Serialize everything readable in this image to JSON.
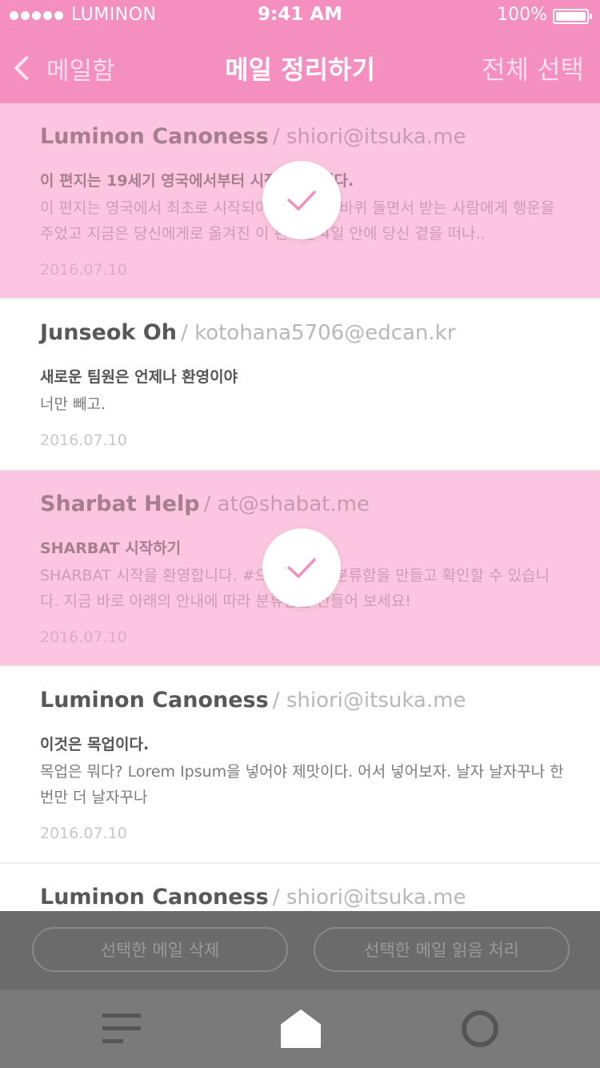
{
  "status_bar": {
    "carrier": "LUMINON",
    "time": "9:41 AM",
    "battery": "100%"
  },
  "nav": {
    "back_label": "메일함",
    "title": "메일 정리하기",
    "action_label": "전체 선택"
  },
  "mails": [
    {
      "sender": "Luminon Canoness",
      "email": "/ shiori@itsuka.me",
      "subject": "이 편지는 19세기 영국에서부터 시작되었습니다.",
      "body": "이 편지는 영국에서 최초로 시작되어 일년에 한 바퀴 돌면서 받는 사람에게 행운을 주었고 지금은 당신에게로 옮겨진 이 편지는 4일 안에 당신 곁을 떠나..",
      "date": "2016.07.10",
      "selected": true
    },
    {
      "sender": "Junseok Oh",
      "email": "/ kotohana5706@edcan.kr",
      "subject": "새로운 팀원은 언제나 환영이야",
      "body": "너만 빼고.",
      "date": "2016.07.10",
      "selected": false
    },
    {
      "sender": "Sharbat Help",
      "email": "/ at@shabat.me",
      "subject": "SHARBAT 시작하기",
      "body": "SHARBAT 시작을 환영합니다. #으로 나만의 분류함을 만들고 확인할 수 있습니다. 지금 바로 아래의 안내에 따라 분류함을 만들어 보세요!",
      "date": "2016.07.10",
      "selected": true
    },
    {
      "sender": "Luminon Canoness",
      "email": "/ shiori@itsuka.me",
      "subject": "이것은 목업이다.",
      "body": "목업은 뭐다? Lorem Ipsum을 넣어야 제맛이다. 어서 넣어보자. 날자 날자꾸나 한번만 더 날자꾸나",
      "date": "2016.07.10",
      "selected": false
    },
    {
      "sender": "Luminon Canoness",
      "email": "/ shiori@itsuka.me",
      "subject": "",
      "body": "",
      "date": "",
      "selected": false
    }
  ],
  "actions": {
    "delete_label": "선택한 메일 삭제",
    "mark_read_label": "선택한 메일 읽음 처리"
  },
  "tabs": [
    {
      "icon": "list-icon"
    },
    {
      "icon": "home-icon"
    },
    {
      "icon": "circle-icon"
    }
  ],
  "colors": {
    "accent": "#f48fc0",
    "selected_row": "#fcc6e1",
    "check_mark": "#f48fc0",
    "action_bar": "#6b6b6b",
    "tab_bar": "#7a7a7a"
  }
}
